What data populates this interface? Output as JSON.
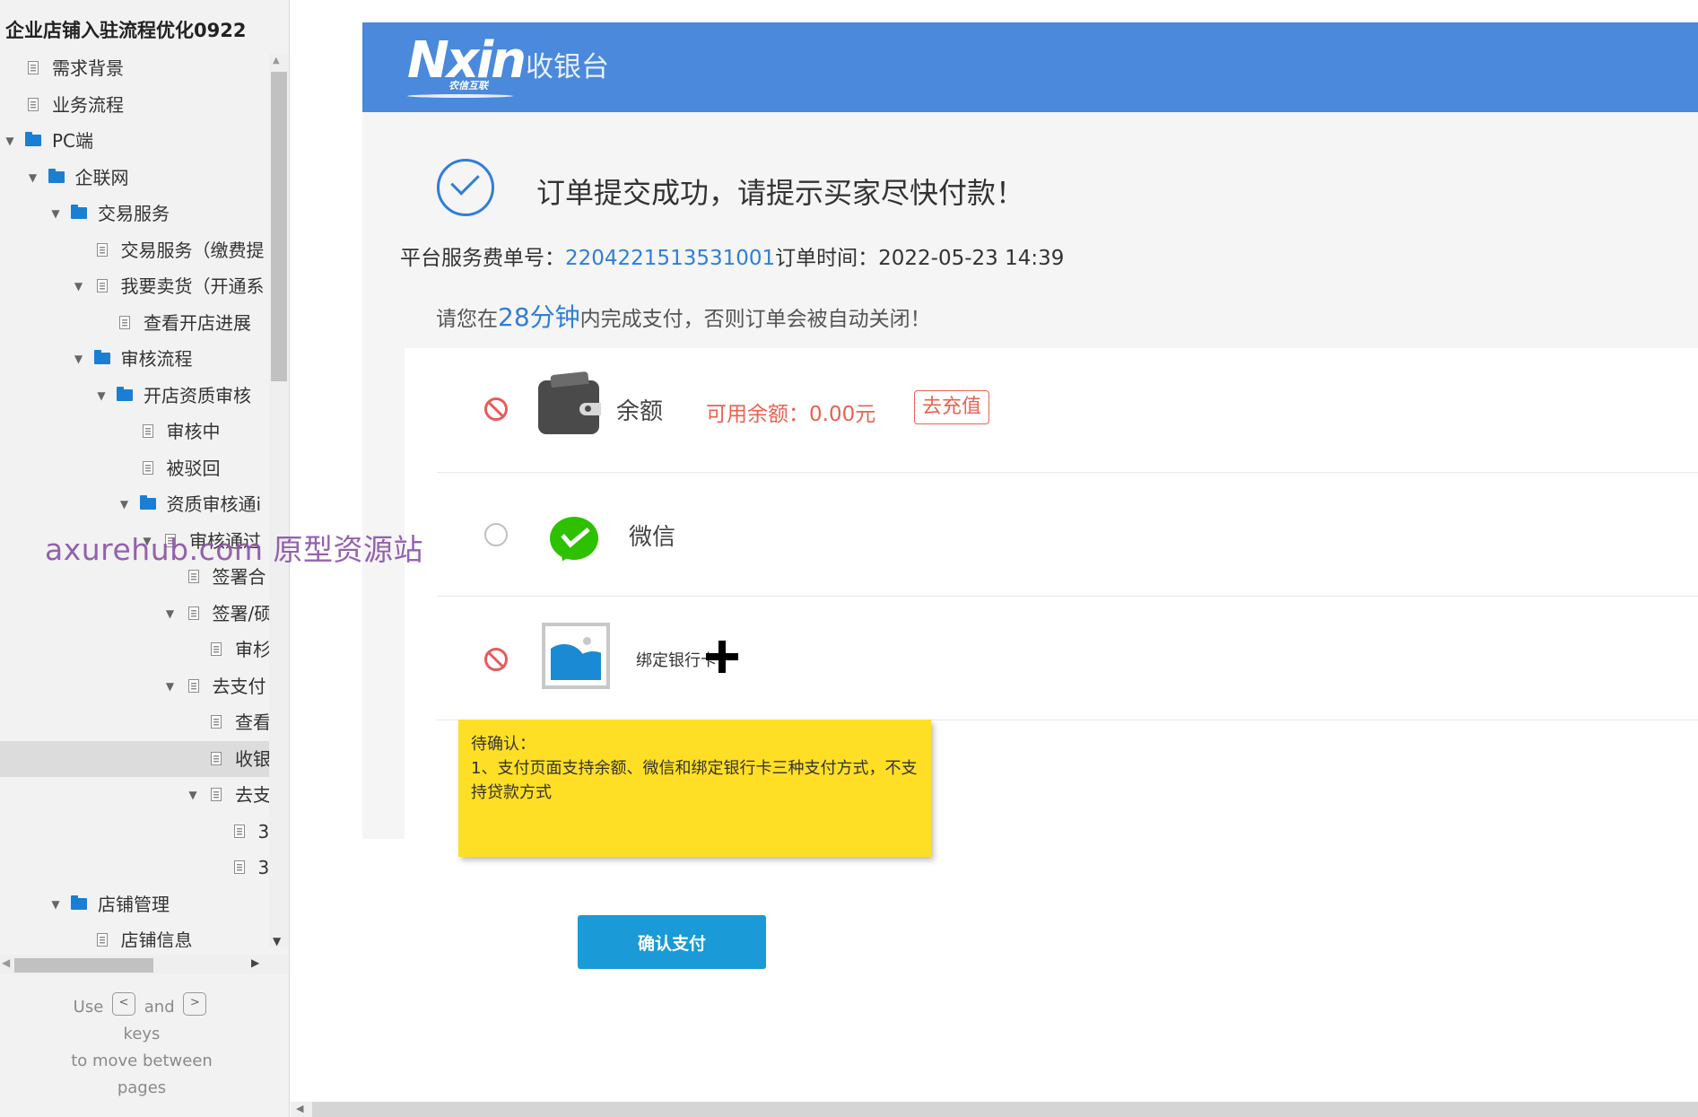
{
  "sidebar": {
    "title": "企业店铺入驻流程优化0922",
    "tree": [
      {
        "label": "需求背景",
        "type": "page",
        "depth": 0,
        "arrow": ""
      },
      {
        "label": "业务流程",
        "type": "page",
        "depth": 0,
        "arrow": ""
      },
      {
        "label": "PC端",
        "type": "folder",
        "depth": 0,
        "arrow": "▼"
      },
      {
        "label": "企联网",
        "type": "folder",
        "depth": 1,
        "arrow": "▼"
      },
      {
        "label": "交易服务",
        "type": "folder",
        "depth": 2,
        "arrow": "▼"
      },
      {
        "label": "交易服务（缴费提",
        "type": "page",
        "depth": 3,
        "arrow": ""
      },
      {
        "label": "我要卖货（开通系",
        "type": "page",
        "depth": 3,
        "arrow": "▼"
      },
      {
        "label": "查看开店进展",
        "type": "page",
        "depth": 4,
        "arrow": ""
      },
      {
        "label": "审核流程",
        "type": "folder",
        "depth": 3,
        "arrow": "▼"
      },
      {
        "label": "开店资质审核",
        "type": "folder",
        "depth": 4,
        "arrow": "▼"
      },
      {
        "label": "审核中",
        "type": "page",
        "depth": 5,
        "arrow": ""
      },
      {
        "label": "被驳回",
        "type": "page",
        "depth": 5,
        "arrow": ""
      },
      {
        "label": "资质审核通i",
        "type": "folder",
        "depth": 5,
        "arrow": "▼"
      },
      {
        "label": "审核通过",
        "type": "page",
        "depth": 6,
        "arrow": "▼"
      },
      {
        "label": "签署合",
        "type": "page",
        "depth": 7,
        "arrow": ""
      },
      {
        "label": "签署/硕",
        "type": "page",
        "depth": 7,
        "arrow": "▼"
      },
      {
        "label": "审杉",
        "type": "page",
        "depth": 8,
        "arrow": ""
      },
      {
        "label": "去支付",
        "type": "page",
        "depth": 7,
        "arrow": "▼"
      },
      {
        "label": "查看",
        "type": "page",
        "depth": 8,
        "arrow": ""
      },
      {
        "label": "收银",
        "type": "page",
        "depth": 8,
        "arrow": "",
        "selected": true
      },
      {
        "label": "去支",
        "type": "page",
        "depth": 8,
        "arrow": "▼"
      },
      {
        "label": "3",
        "type": "page",
        "depth": 9,
        "arrow": ""
      },
      {
        "label": "3",
        "type": "page",
        "depth": 9,
        "arrow": ""
      },
      {
        "label": "店铺管理",
        "type": "folder",
        "depth": 2,
        "arrow": "▼"
      },
      {
        "label": "店铺信息",
        "type": "page",
        "depth": 3,
        "arrow": ""
      }
    ],
    "hint": {
      "use": "Use",
      "key_prev": "<",
      "and": "and",
      "key_next": ">",
      "keys": "keys",
      "to_move": "to move between",
      "pages": "pages"
    }
  },
  "watermark": "axurehub.com 原型资源站",
  "header": {
    "logo_text": "Nxin",
    "logo_sub": "农信互联",
    "title": "收银台"
  },
  "order": {
    "success_message": "订单提交成功，请提示买家尽快付款！",
    "fee_no_label": "平台服务费单号：",
    "fee_no": "2204221513531001",
    "time_label": "订单时间：",
    "time": "2022-05-23 14:39",
    "tip_prefix": "请您在",
    "tip_minutes": "28分钟",
    "tip_suffix": "内完成支付，否则订单会被自动关闭！"
  },
  "payment_methods": {
    "balance": {
      "label": "余额",
      "available": "可用余额：0.00元",
      "recharge": "去充值",
      "icon": "wallet-icon"
    },
    "wechat": {
      "label": "微信",
      "icon": "wechat-icon"
    },
    "bank": {
      "label": "绑定银行卡",
      "icon": "image-placeholder-icon"
    }
  },
  "note": {
    "title": "待确认：",
    "body": "1、支付页面支持余额、微信和绑定银行卡三种支付方式，不支持贷款方式"
  },
  "confirm_label": "确认支付",
  "colors": {
    "header": "#4a89dc",
    "accent": "#2f7ed8",
    "warning": "#e8624f",
    "note": "#ffdf25",
    "button": "#1a9ad6"
  }
}
